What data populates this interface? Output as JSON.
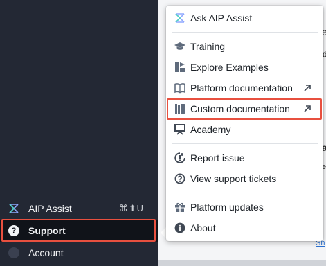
{
  "sidebar": {
    "aip_assist": {
      "label": "AIP Assist",
      "icon": "aip-logo-icon",
      "shortcut": "⌘⬆U"
    },
    "support": {
      "label": "Support",
      "icon": "help-icon"
    },
    "account": {
      "label": "Account",
      "icon": "avatar-icon"
    }
  },
  "menu": {
    "items": [
      {
        "label": "Ask AIP Assist",
        "icon": "aip-logo-icon"
      },
      {
        "label": "Training",
        "icon": "graduation-cap-icon"
      },
      {
        "label": "Explore Examples",
        "icon": "examples-icon"
      },
      {
        "label": "Platform documentation",
        "icon": "book-icon",
        "external": "↗"
      },
      {
        "label": "Custom documentation",
        "icon": "library-icon",
        "external": "↗"
      },
      {
        "label": "Academy",
        "icon": "presentation-icon"
      },
      {
        "label": "Report issue",
        "icon": "issue-icon"
      },
      {
        "label": "View support tickets",
        "icon": "help-icon"
      },
      {
        "label": "Platform updates",
        "icon": "gift-icon"
      },
      {
        "label": "About",
        "icon": "info-icon"
      }
    ]
  },
  "background": {
    "edge_fragments": [
      "e",
      "d",
      "a",
      "e",
      "Sh"
    ]
  },
  "colors": {
    "sidebar_bg": "#232834",
    "selected_bg": "#101319",
    "highlight": "#e8503f",
    "menu_text": "#1c2127",
    "icon": "#5f6b7c"
  }
}
